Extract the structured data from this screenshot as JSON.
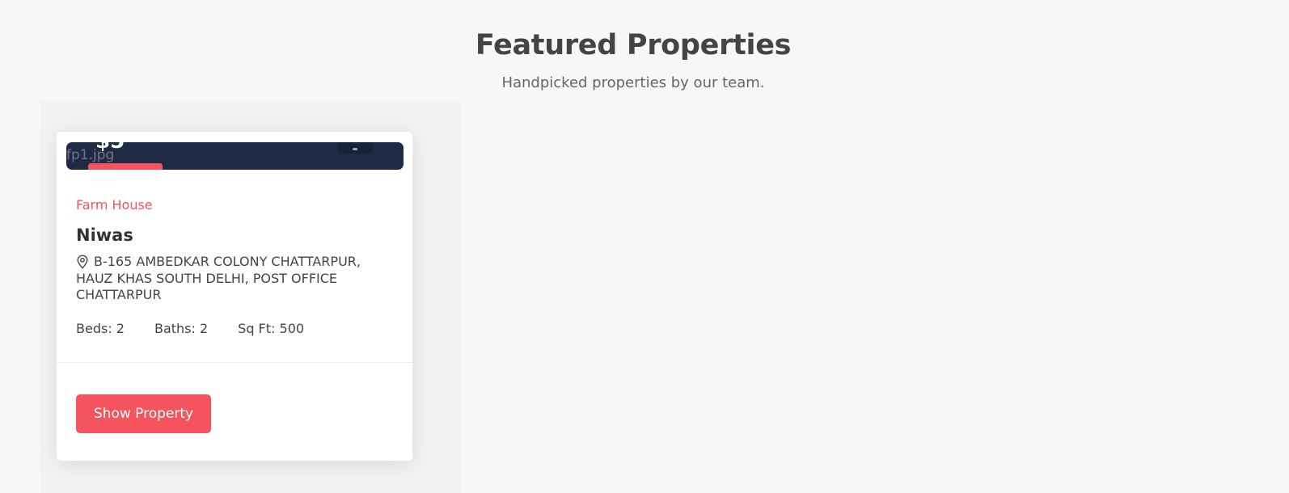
{
  "section": {
    "title": "Featured Properties",
    "subtitle": "Handpicked properties by our team."
  },
  "property": {
    "image_alt": "fp1.jpg",
    "price": "$5",
    "type": "Farm House",
    "name": "Niwas",
    "address": "B-165 AMBEDKAR COLONY CHATTARPUR, HAUZ KHAS SOUTH DELHI, POST OFFICE CHATTARPUR",
    "beds": "Beds: 2",
    "baths": "Baths: 2",
    "sqft": "Sq Ft: 500",
    "button_label": "Show Property"
  },
  "colors": {
    "accent": "#f5535d",
    "image_bg": "#1f2a44",
    "page_bg": "#f7f7f7"
  },
  "icons": {
    "address": "map-pin-icon"
  }
}
